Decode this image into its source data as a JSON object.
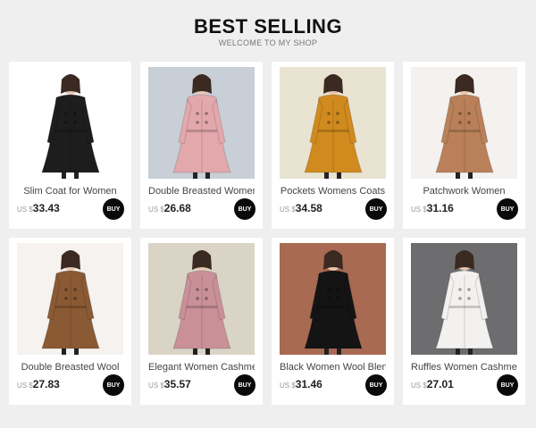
{
  "header": {
    "title": "BEST SELLING",
    "subtitle": "WELCOME TO MY SHOP"
  },
  "products": [
    {
      "name": "Slim Coat for Women",
      "currency": "US $",
      "price": "33.43",
      "buy": "BUY",
      "coat_color": "#1d1d1d",
      "bg_color": "#ffffff"
    },
    {
      "name": "Double Breasted Women",
      "currency": "US $",
      "price": "26.68",
      "buy": "BUY",
      "coat_color": "#e3a8ac",
      "bg_color": "#c9cfd6"
    },
    {
      "name": "Pockets Womens Coats",
      "currency": "US $",
      "price": "34.58",
      "buy": "BUY",
      "coat_color": "#d08a1e",
      "bg_color": "#e9e3d2"
    },
    {
      "name": "Patchwork Women",
      "currency": "US $",
      "price": "31.16",
      "buy": "BUY",
      "coat_color": "#b9805a",
      "bg_color": "#f4f1ee"
    },
    {
      "name": "Double Breasted Wool",
      "currency": "US $",
      "price": "27.83",
      "buy": "BUY",
      "coat_color": "#8a5a34",
      "bg_color": "#f5f2ef"
    },
    {
      "name": "Elegant Women Cashmer",
      "currency": "US $",
      "price": "35.57",
      "buy": "BUY",
      "coat_color": "#c99098",
      "bg_color": "#d9d4c6"
    },
    {
      "name": "Black Women Wool Blend",
      "currency": "US $",
      "price": "31.46",
      "buy": "BUY",
      "coat_color": "#141414",
      "bg_color": "#a86a52"
    },
    {
      "name": "Ruffles Women Cashmer",
      "currency": "US $",
      "price": "27.01",
      "buy": "BUY",
      "coat_color": "#f3f1ef",
      "bg_color": "#6d6d6f"
    }
  ]
}
